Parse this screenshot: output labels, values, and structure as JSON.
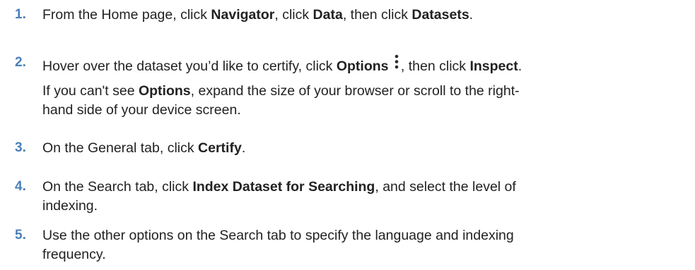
{
  "steps": [
    {
      "number": "1.",
      "t1": "From the Home page, click ",
      "b1": "Navigator",
      "t2": ", click ",
      "b2": "Data",
      "t3": ", then click ",
      "b3": "Datasets",
      "t4": "."
    },
    {
      "number": "2.",
      "t1": "Hover over the dataset you’d like to certify, click ",
      "b1": "Options",
      "icon": "options-kebab-icon",
      "t2": ", then click ",
      "b2": "Inspect",
      "t3": ".",
      "note": {
        "t1": "If you can't see ",
        "b1": "Options",
        "t2": ", expand the size of your browser or scroll to the right-",
        "t3": "hand side of your device screen."
      }
    },
    {
      "number": "3.",
      "t1": "On the General tab, click ",
      "b1": "Certify",
      "t2": "."
    },
    {
      "number": "4.",
      "t1": "On the Search tab, click ",
      "b1": "Index Dataset for Searching",
      "t2": ", and select the level of",
      "t3": "indexing."
    },
    {
      "number": "5.",
      "t1": "Use the other options on the Search tab to specify the language and indexing",
      "t2": "frequency."
    }
  ],
  "colors": {
    "step_number": "#4a80b8",
    "text": "#222222"
  }
}
